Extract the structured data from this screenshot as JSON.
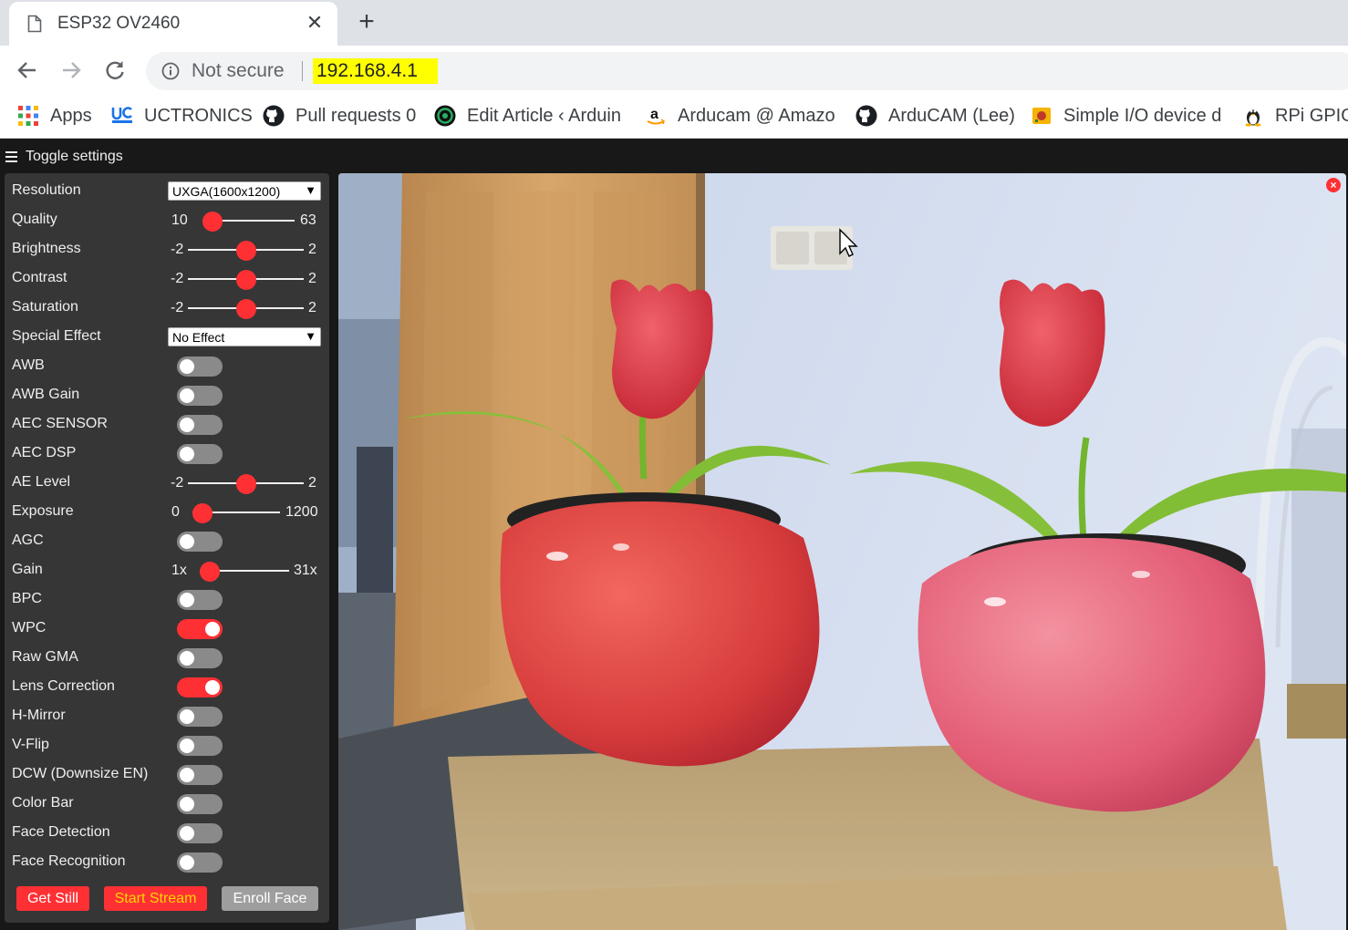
{
  "browser": {
    "tab_title": "ESP32 OV2460",
    "tab_close": "✕",
    "new_tab": "+",
    "security_label": "Not secure",
    "url": "192.168.4.1"
  },
  "bookmarks": [
    {
      "label": "Apps",
      "icon": "apps-grid-icon"
    },
    {
      "label": "UCTRONICS",
      "icon": "uctronics-icon"
    },
    {
      "label": "Pull requests 0",
      "icon": "github-icon"
    },
    {
      "label": "Edit Article ‹ Arduin",
      "icon": "wordpress-icon"
    },
    {
      "label": "Arducam @ Amazo",
      "icon": "amazon-icon"
    },
    {
      "label": "ArduCAM (Lee)",
      "icon": "github-icon"
    },
    {
      "label": "Simple I/O device d",
      "icon": "io-device-icon"
    },
    {
      "label": "RPi GPIO",
      "icon": "linux-tux-icon"
    }
  ],
  "page": {
    "toggle_settings": "Toggle settings",
    "controls": {
      "resolution": {
        "label": "Resolution",
        "value": "UXGA(1600x1200)"
      },
      "quality": {
        "label": "Quality",
        "min": "10",
        "max": "63",
        "value": 10
      },
      "brightness": {
        "label": "Brightness",
        "min": "-2",
        "max": "2",
        "value": 0
      },
      "contrast": {
        "label": "Contrast",
        "min": "-2",
        "max": "2",
        "value": 0
      },
      "saturation": {
        "label": "Saturation",
        "min": "-2",
        "max": "2",
        "value": 0
      },
      "special_effect": {
        "label": "Special Effect",
        "value": "No Effect"
      },
      "awb": {
        "label": "AWB",
        "on": false
      },
      "awb_gain": {
        "label": "AWB Gain",
        "on": false
      },
      "aec_sensor": {
        "label": "AEC SENSOR",
        "on": false
      },
      "aec_dsp": {
        "label": "AEC DSP",
        "on": false
      },
      "ae_level": {
        "label": "AE Level",
        "min": "-2",
        "max": "2",
        "value": 0
      },
      "exposure": {
        "label": "Exposure",
        "min": "0",
        "max": "1200",
        "value": 0
      },
      "agc": {
        "label": "AGC",
        "on": false
      },
      "gain": {
        "label": "Gain",
        "min": "1x",
        "max": "31x",
        "value": 1
      },
      "bpc": {
        "label": "BPC",
        "on": false
      },
      "wpc": {
        "label": "WPC",
        "on": true
      },
      "raw_gma": {
        "label": "Raw GMA",
        "on": false
      },
      "lens_correction": {
        "label": "Lens Correction",
        "on": true
      },
      "h_mirror": {
        "label": "H-Mirror",
        "on": false
      },
      "v_flip": {
        "label": "V-Flip",
        "on": false
      },
      "dcw": {
        "label": "DCW (Downsize EN)",
        "on": false
      },
      "color_bar": {
        "label": "Color Bar",
        "on": false
      },
      "face_detection": {
        "label": "Face Detection",
        "on": false
      },
      "face_recognition": {
        "label": "Face Recognition",
        "on": false
      }
    },
    "buttons": {
      "get_still": "Get Still",
      "start_stream": "Start Stream",
      "enroll_face": "Enroll Face"
    },
    "stream_close": "×"
  },
  "colors": {
    "accent": "#ff3034",
    "panel": "#363636",
    "page_bg": "#181818",
    "url_highlight": "#ffff00"
  }
}
